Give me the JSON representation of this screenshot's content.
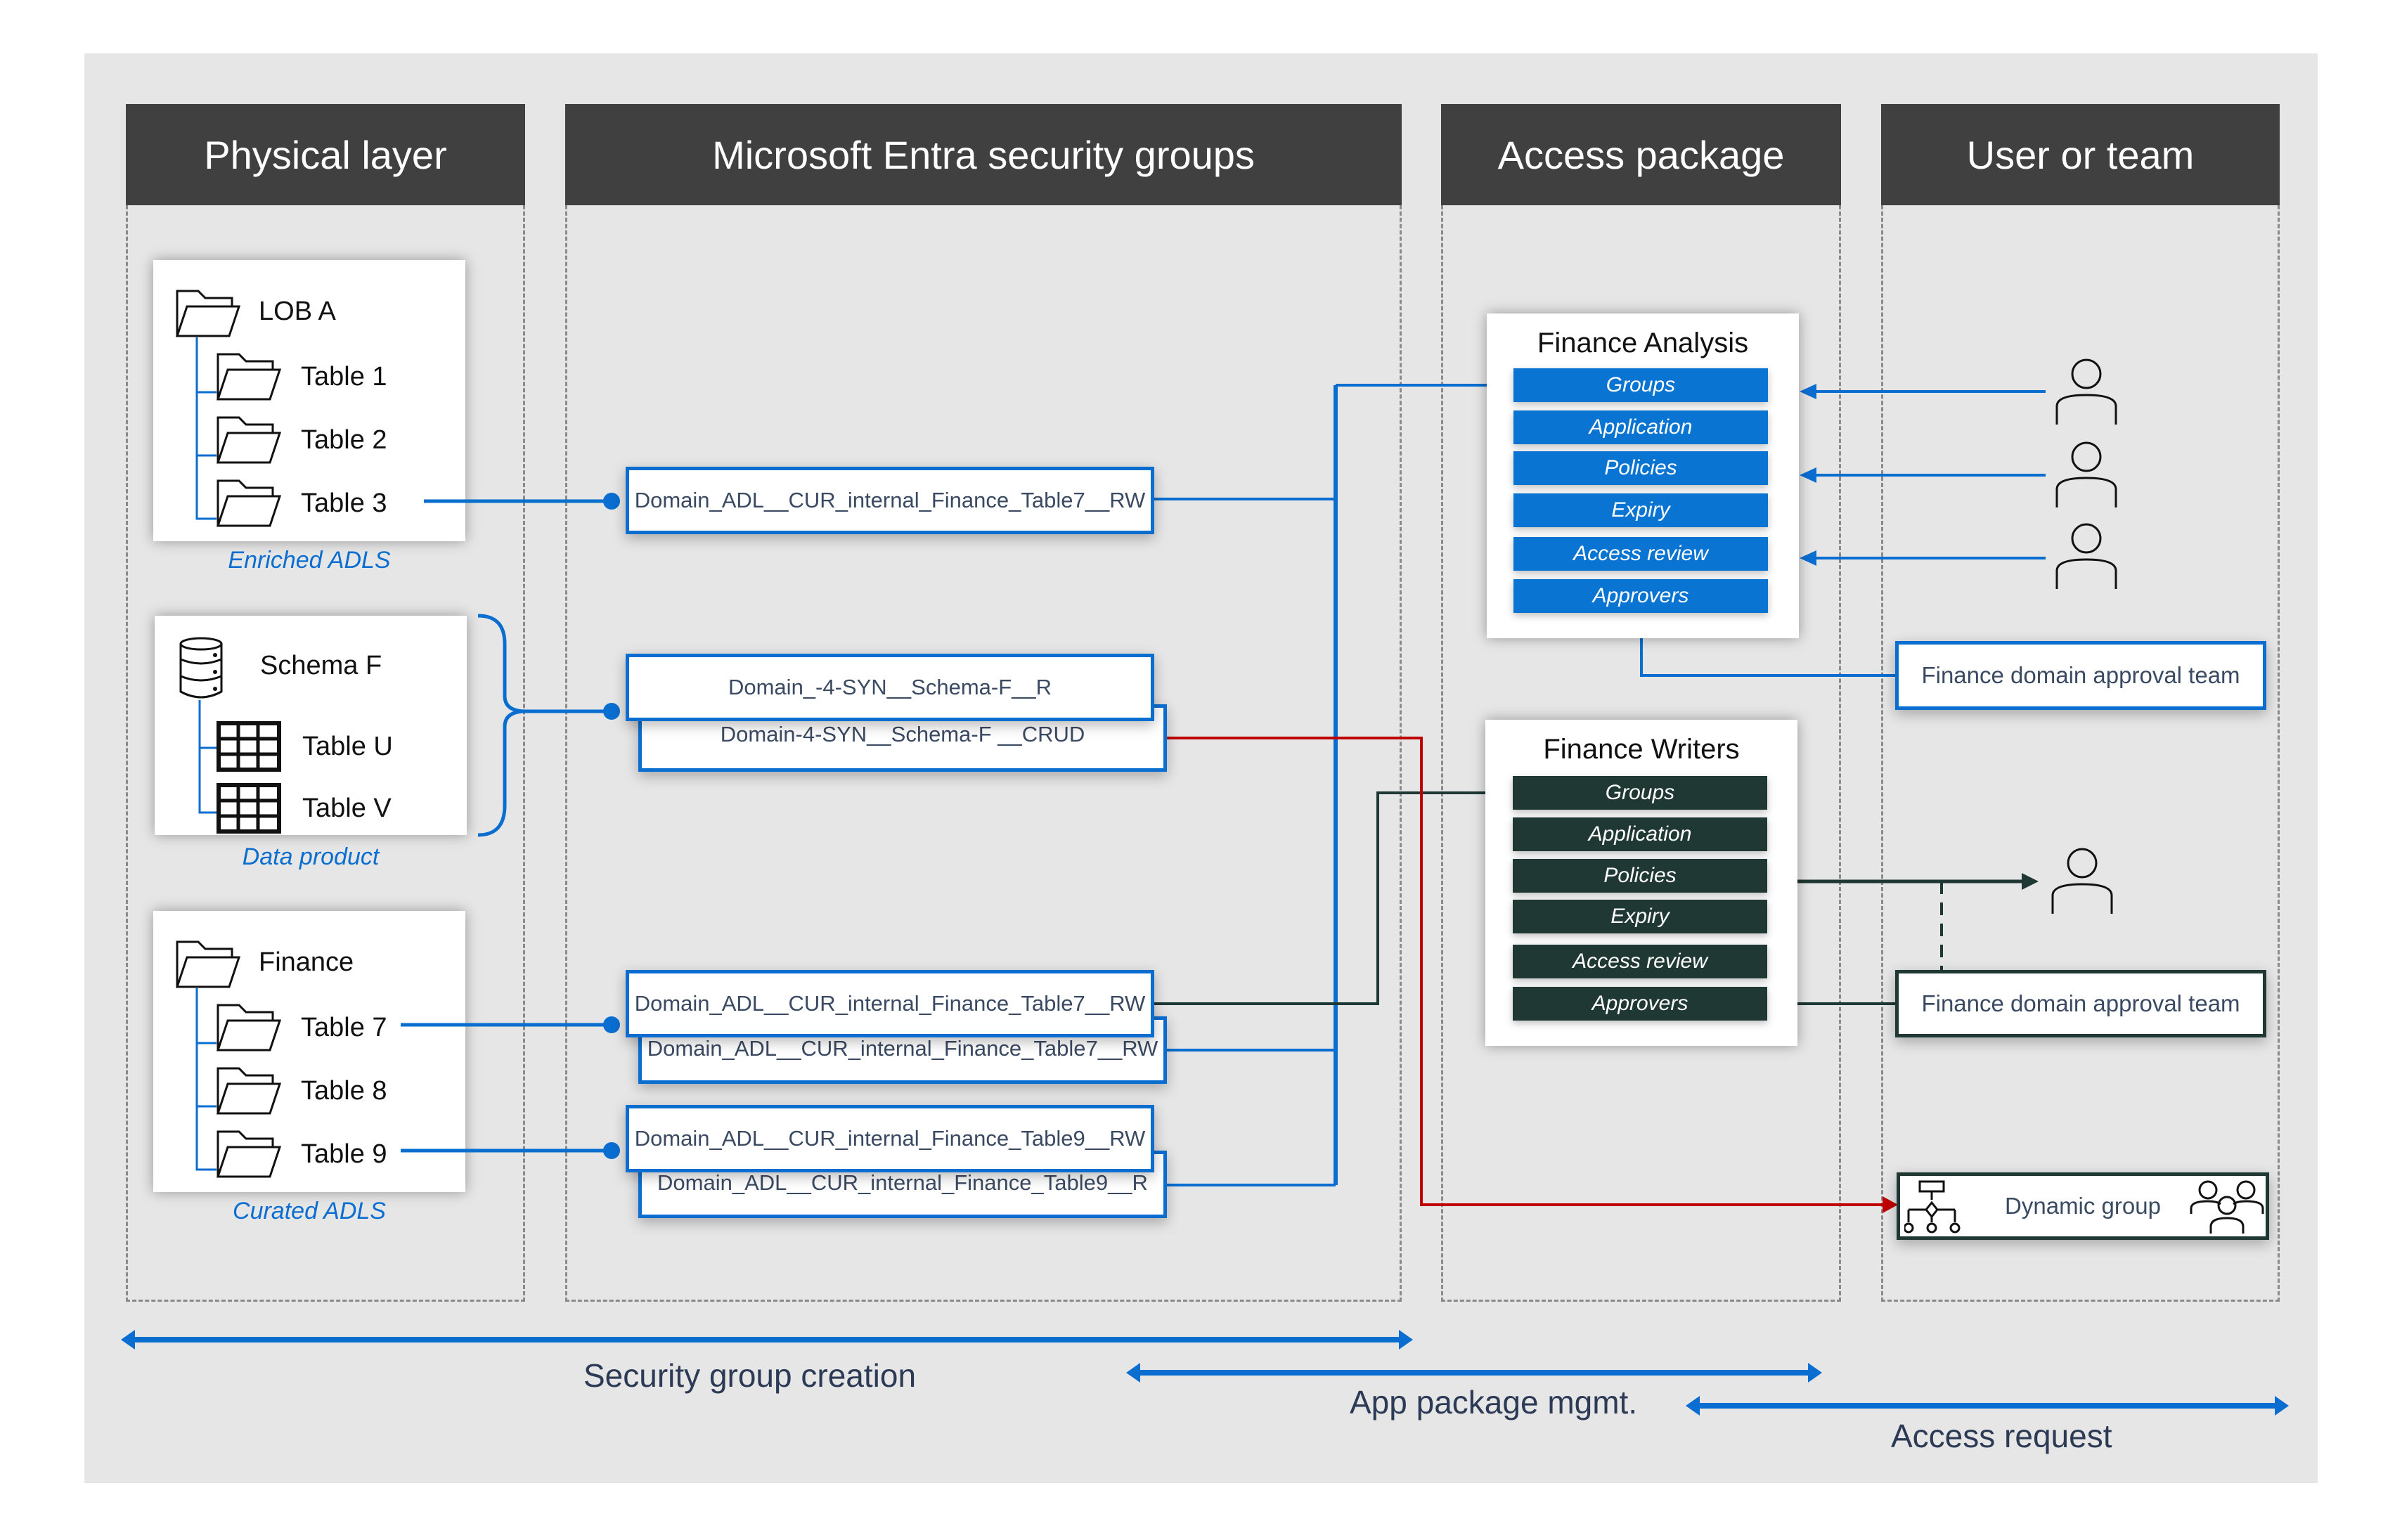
{
  "columns": [
    {
      "title": "Physical layer"
    },
    {
      "title": "Microsoft Entra security groups"
    },
    {
      "title": "Access package"
    },
    {
      "title": "User or team"
    }
  ],
  "physical": {
    "lob_a": {
      "root": "LOB A",
      "children": [
        "Table 1",
        "Table 2",
        "Table 3"
      ],
      "caption": "Enriched ADLS"
    },
    "schema_f": {
      "root": "Schema F",
      "children": [
        "Table U",
        "Table V"
      ],
      "caption": "Data product"
    },
    "finance": {
      "root": "Finance",
      "children": [
        "Table 7",
        "Table 8",
        "Table 9"
      ],
      "caption": "Curated ADLS"
    }
  },
  "security_groups": [
    {
      "front": "Domain_ADL__CUR_internal_Finance_Table7__RW"
    },
    {
      "front": "Domain_-4-SYN__Schema-F__R",
      "back": "Domain-4-SYN__Schema-F __CRUD"
    },
    {
      "front": "Domain_ADL__CUR_internal_Finance_Table7__RW",
      "back": "Domain_ADL__CUR_internal_Finance_Table7__RW"
    },
    {
      "front": "Domain_ADL__CUR_internal_Finance_Table9__RW",
      "back": "Domain_ADL__CUR_internal_Finance_Table9__R"
    }
  ],
  "access_packages": [
    {
      "title": "Finance Analysis",
      "items": [
        "Groups",
        "Application",
        "Policies",
        "Expiry",
        "Access review",
        "Approvers"
      ],
      "color": "#0a74d2"
    },
    {
      "title": "Finance Writers",
      "items": [
        "Groups",
        "Application",
        "Policies",
        "Expiry",
        "Access review",
        "Approvers"
      ],
      "color": "#1f3834"
    }
  ],
  "users": {
    "approval_team_1": "Finance domain approval team",
    "approval_team_2": "Finance domain approval team",
    "dynamic_group": "Dynamic group"
  },
  "phases": [
    {
      "label": "Security group creation"
    },
    {
      "label": "App package mgmt."
    },
    {
      "label": "Access request"
    }
  ],
  "colors": {
    "accent_blue": "#0a74d2",
    "dark_green": "#1f3834",
    "red": "#c00000",
    "header": "#404040",
    "background": "#e6e6e6"
  }
}
